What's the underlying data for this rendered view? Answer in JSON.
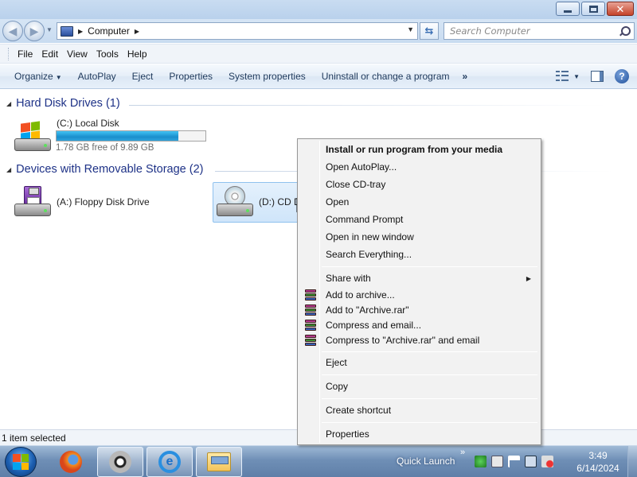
{
  "window": {
    "controls": {
      "minimize_icon": "minimize-icon",
      "maximize_icon": "restore-icon",
      "close_icon": "close-icon"
    }
  },
  "address": {
    "path": [
      "Computer"
    ],
    "search_placeholder": "Search Computer"
  },
  "menubar": {
    "items": [
      {
        "label": "File"
      },
      {
        "label": "Edit"
      },
      {
        "label": "View"
      },
      {
        "label": "Tools"
      },
      {
        "label": "Help"
      }
    ]
  },
  "toolbar": {
    "organize": "Organize",
    "autoplay": "AutoPlay",
    "eject": "Eject",
    "properties": "Properties",
    "system_properties": "System properties",
    "uninstall": "Uninstall or change a program",
    "more": "»"
  },
  "groups": [
    {
      "title": "Hard Disk Drives (1)",
      "drives": [
        {
          "label": "(C:) Local Disk",
          "free_text": "1.78 GB free of 9.89 GB",
          "used_fraction": 0.82
        }
      ]
    },
    {
      "title": "Devices with Removable Storage (2)",
      "drives": [
        {
          "label": "(A:) Floppy Disk Drive"
        },
        {
          "label": "(D:) CD D"
        }
      ]
    }
  ],
  "status": {
    "text": "1 item selected"
  },
  "context_menu": {
    "items": [
      {
        "label": "Install or run program from your media",
        "bold": true
      },
      {
        "label": "Open AutoPlay..."
      },
      {
        "label": "Close CD-tray"
      },
      {
        "label": "Open"
      },
      {
        "label": "Command Prompt"
      },
      {
        "label": "Open in new window"
      },
      {
        "label": "Search Everything..."
      },
      {
        "label": "Share with",
        "submenu": true
      },
      {
        "label": "Add to archive...",
        "icon": "winrar-icon"
      },
      {
        "label": "Add to \"Archive.rar\"",
        "icon": "winrar-icon"
      },
      {
        "label": "Compress and email...",
        "icon": "winrar-icon"
      },
      {
        "label": "Compress to \"Archive.rar\" and email",
        "icon": "winrar-icon"
      },
      {
        "label": "Eject"
      },
      {
        "label": "Copy"
      },
      {
        "label": "Create shortcut"
      },
      {
        "label": "Properties"
      }
    ]
  },
  "taskbar": {
    "quick_launch": "Quick Launch",
    "chevron": "»",
    "clock_time": "3:49",
    "clock_date": "6/14/2024"
  }
}
